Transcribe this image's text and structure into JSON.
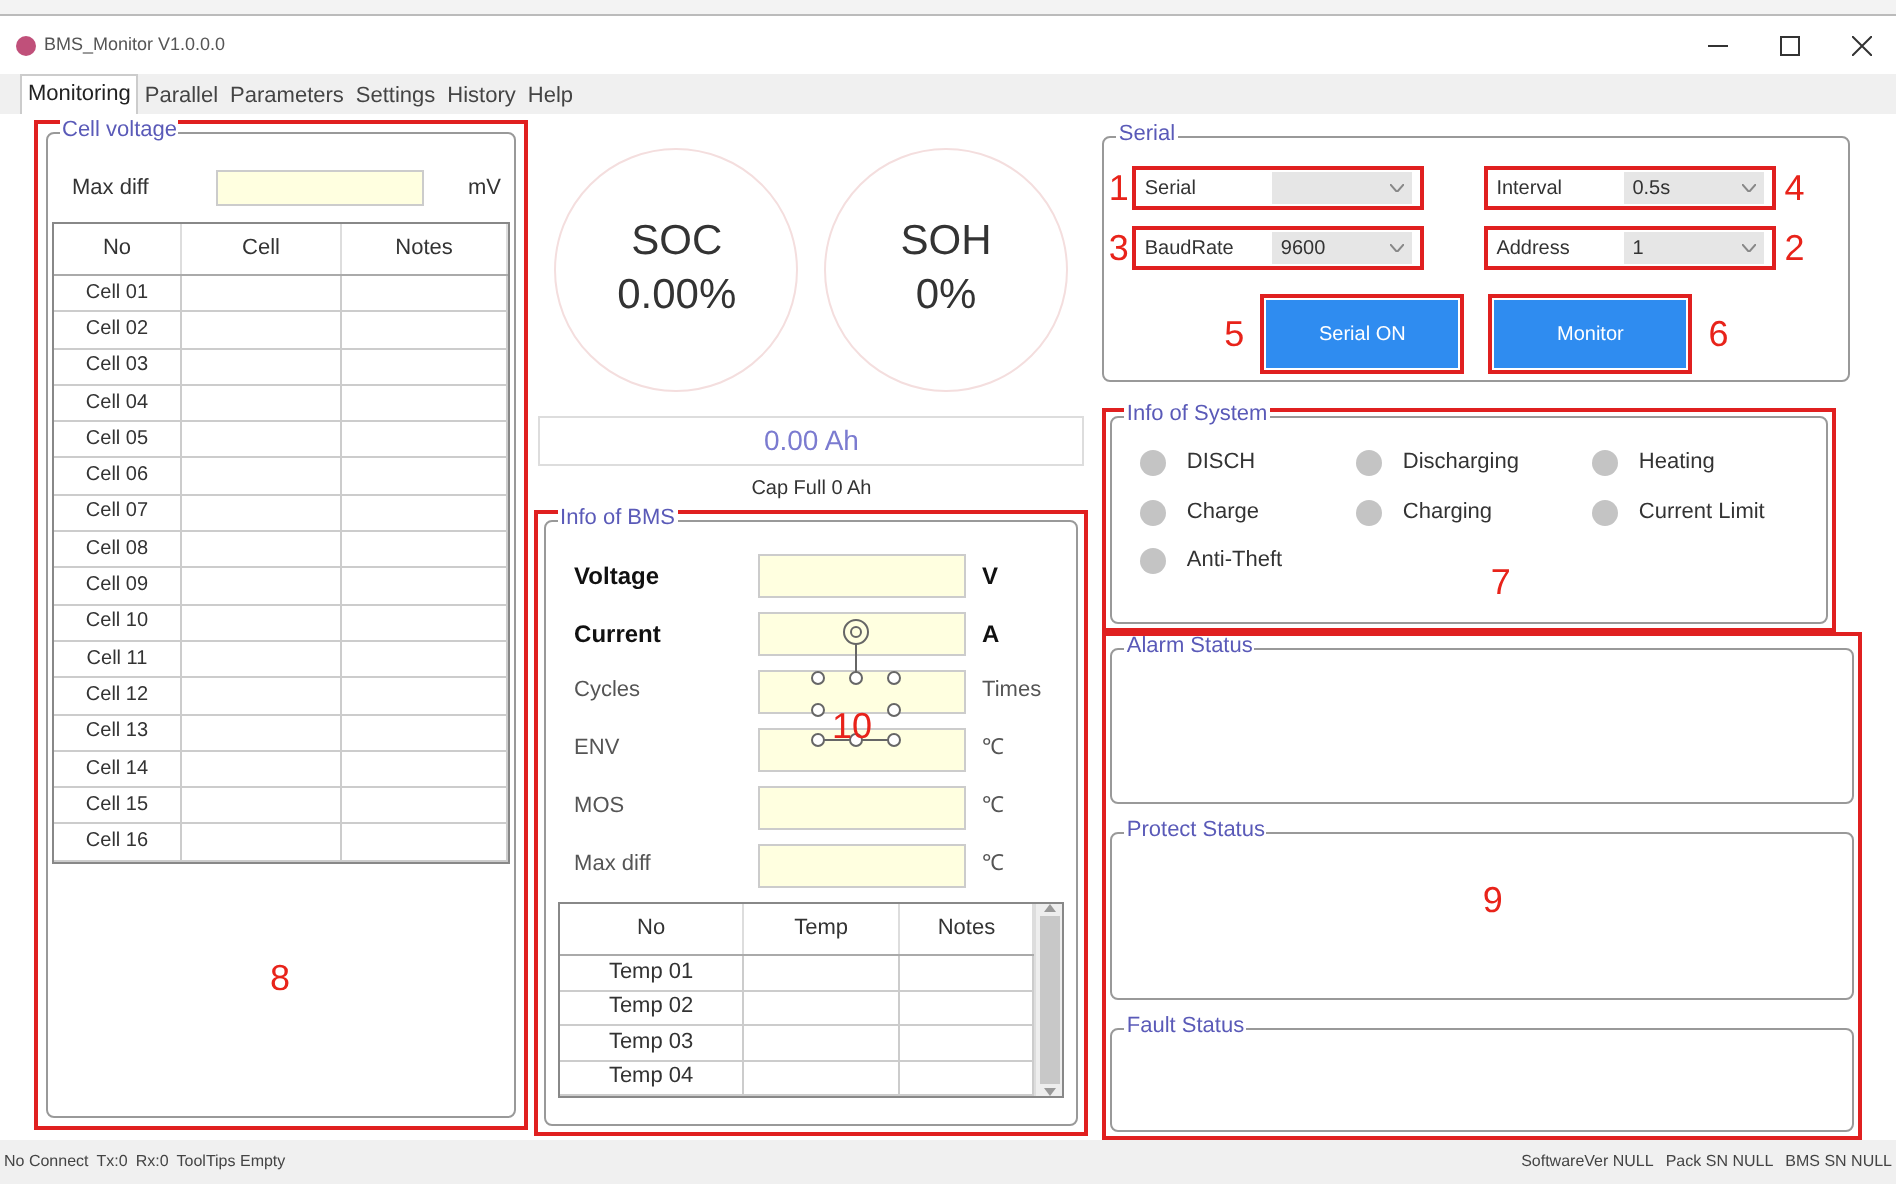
{
  "window": {
    "title": "BMS_Monitor V1.0.0.0"
  },
  "tabs": [
    {
      "label": "Monitoring",
      "selected": true
    },
    {
      "label": "Parallel",
      "selected": false
    },
    {
      "label": "Parameters",
      "selected": false
    },
    {
      "label": "Settings",
      "selected": false
    },
    {
      "label": "History",
      "selected": false
    },
    {
      "label": "Help",
      "selected": false
    }
  ],
  "cell_voltage": {
    "title": "Cell voltage",
    "annotation": "8",
    "max_diff": {
      "label": "Max diff",
      "unit": "mV"
    },
    "columns": [
      "No",
      "Cell",
      "Notes"
    ],
    "rows": [
      "Cell 01",
      "Cell 02",
      "Cell 03",
      "Cell 04",
      "Cell 05",
      "Cell 06",
      "Cell 07",
      "Cell 08",
      "Cell 09",
      "Cell 10",
      "Cell 11",
      "Cell 12",
      "Cell 13",
      "Cell 14",
      "Cell 15",
      "Cell 16"
    ]
  },
  "gauges": [
    {
      "label": "SOC",
      "value": "0.00%"
    },
    {
      "label": "SOH",
      "value": "0%"
    }
  ],
  "capacity": {
    "value": "0.00 Ah",
    "caption": "Cap Full 0 Ah"
  },
  "bms_info": {
    "title": "Info of BMS",
    "annotation": "10",
    "fields": [
      {
        "label": "Voltage",
        "unit": "V",
        "kind": "primary"
      },
      {
        "label": "Current",
        "unit": "A",
        "kind": "primary"
      },
      {
        "label": "Cycles",
        "unit": "Times",
        "kind": "secondary"
      },
      {
        "label": "ENV",
        "unit": "℃",
        "kind": "secondary"
      },
      {
        "label": "MOS",
        "unit": "℃",
        "kind": "secondary"
      },
      {
        "label": "Max diff",
        "unit": "℃",
        "kind": "secondary"
      }
    ],
    "columns": [
      "No",
      "Temp",
      "Notes"
    ],
    "rows": [
      "Temp 01",
      "Temp 02",
      "Temp 03",
      "Temp 04"
    ]
  },
  "serial": {
    "title": "Serial",
    "selects": [
      {
        "label": "Serial",
        "annotation": "1"
      },
      {
        "label": "Interval",
        "value": "0.5s",
        "annotation": "4"
      },
      {
        "label": "BaudRate",
        "value": "9600",
        "annotation": "3"
      },
      {
        "label": "Address",
        "value": "1",
        "annotation": "2"
      }
    ],
    "buttons": [
      {
        "label": "Serial ON",
        "annotation": "5"
      },
      {
        "label": "Monitor",
        "annotation": "6"
      }
    ]
  },
  "system_info": {
    "title": "Info of System",
    "annotation": "7",
    "indicators": [
      {
        "label": "DISCH",
        "on": false
      },
      {
        "label": "Discharging",
        "on": false
      },
      {
        "label": "Heating",
        "on": false
      },
      {
        "label": "Charge",
        "on": false
      },
      {
        "label": "Charging",
        "on": false
      },
      {
        "label": "Current Limit",
        "on": false
      },
      {
        "label": "Anti-Theft",
        "on": false
      }
    ]
  },
  "status_groups": {
    "annotation": "9",
    "groups": [
      {
        "title": "Alarm Status"
      },
      {
        "title": "Protect Status"
      },
      {
        "title": "Fault Status"
      }
    ]
  },
  "status_bar": {
    "left": [
      "No Connect",
      "Tx:0",
      "Rx:0",
      "ToolTips Empty"
    ],
    "right": [
      "SoftwareVer NULL",
      "Pack SN NULL",
      "BMS SN NULL"
    ]
  }
}
